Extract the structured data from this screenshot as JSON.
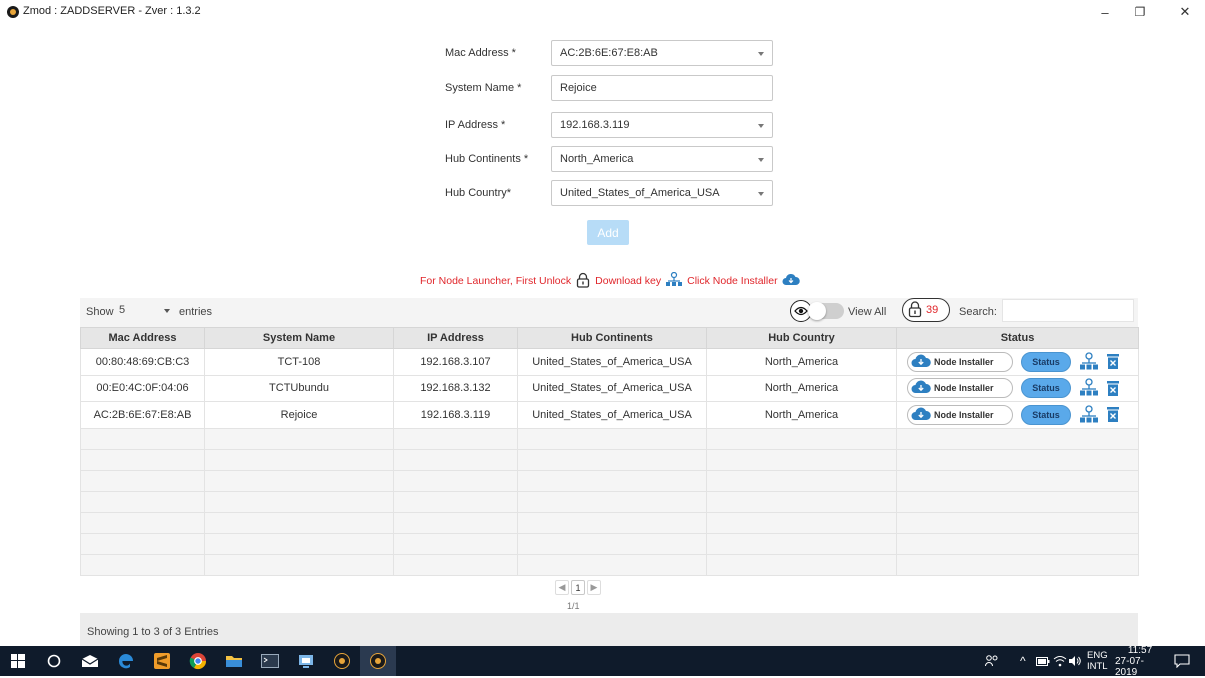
{
  "window": {
    "title": "Zmod : ZADDSERVER - Zver : 1.3.2",
    "minimize": "–",
    "maximize": "❐",
    "close": "✕"
  },
  "form": {
    "mac_label": "Mac Address *",
    "mac_value": "AC:2B:6E:67:E8:AB",
    "system_label": "System Name *",
    "system_value": "Rejoice",
    "ip_label": "IP Address *",
    "ip_value": "192.168.3.119",
    "continent_label": "Hub Continents *",
    "continent_value": "North_America",
    "country_label": "Hub Country*",
    "country_value": "United_States_of_America_USA",
    "add_label": "Add"
  },
  "hint": {
    "part1": "For Node Launcher, First Unlock",
    "part2": "Download key",
    "part3": "Click Node Installer"
  },
  "table_controls": {
    "show_label": "Show",
    "show_value": "5",
    "entries_label": "entries",
    "view_all_label": "View All",
    "lock_count": "39",
    "search_label": "Search:",
    "search_value": ""
  },
  "table": {
    "headers": [
      "Mac Address",
      "System Name",
      "IP Address",
      "Hub Continents",
      "Hub Country",
      "Status"
    ],
    "rows": [
      [
        "00:80:48:69:CB:C3",
        "TCT-108",
        "192.168.3.107",
        "United_States_of_America_USA",
        "North_America"
      ],
      [
        "00:E0:4C:0F:04:06",
        "TCTUbundu",
        "192.168.3.132",
        "United_States_of_America_USA",
        "North_America"
      ],
      [
        "AC:2B:6E:67:E8:AB",
        "Rejoice",
        "192.168.3.119",
        "United_States_of_America_USA",
        "North_America"
      ]
    ],
    "node_installer_label": "Node Installer",
    "status_label": "Status"
  },
  "pagination": {
    "prev": "◀",
    "current": "1",
    "next": "▶",
    "page_of": "1/1"
  },
  "footer": {
    "info": "Showing 1 to 3 of 3 Entries"
  },
  "taskbar": {
    "lang_top": "ENG",
    "lang_bottom": "INTL",
    "time": "11:57",
    "date": "27-07-2019"
  },
  "colors": {
    "accent_blue": "#5aa9ea",
    "hint_red": "#e0262b",
    "taskbar": "#0f1b2b"
  }
}
